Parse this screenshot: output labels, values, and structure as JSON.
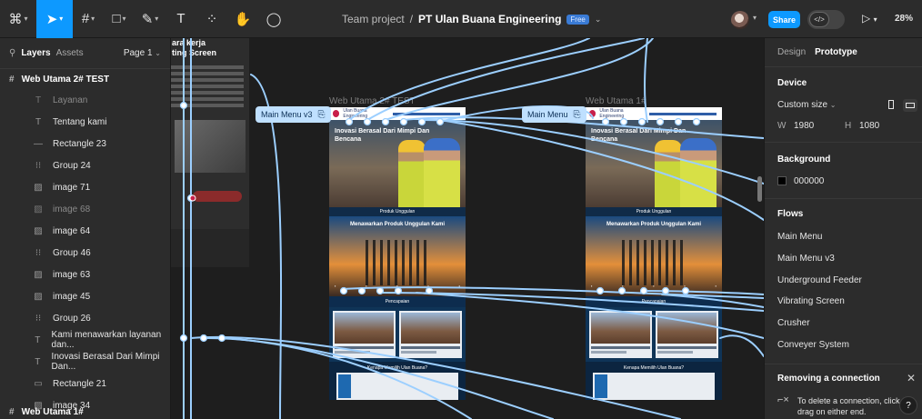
{
  "toolbar": {
    "main_menu_icon": "figma-logo-icon",
    "tools": [
      "move-tool-icon",
      "frame-tool-icon",
      "shape-tool-icon",
      "pen-tool-icon",
      "text-tool-icon",
      "resources-icon",
      "hand-tool-icon",
      "comment-icon"
    ],
    "text_tool_glyph": "T",
    "team": "Team project",
    "separator": "/",
    "file_name": "PT Ulan Buana Engineering",
    "plan_badge": "Free",
    "share_label": "Share",
    "zoom": "28%"
  },
  "left_panel": {
    "tab_layers": "Layers",
    "tab_assets": "Assets",
    "page": "Page 1",
    "top_frame": "Web Utama 2# TEST",
    "layers": [
      {
        "icon": "text-icon",
        "label": "Layanan",
        "dim": true
      },
      {
        "icon": "text-icon",
        "label": "Tentang kami",
        "dim": false
      },
      {
        "icon": "line-icon",
        "label": "Rectangle 23",
        "dim": false
      },
      {
        "icon": "group-icon",
        "label": "Group 24",
        "dim": false
      },
      {
        "icon": "image-icon",
        "label": "image 71",
        "dim": false
      },
      {
        "icon": "image-icon",
        "label": "image 68",
        "dim": true
      },
      {
        "icon": "image-icon",
        "label": "image 64",
        "dim": false
      },
      {
        "icon": "group-icon",
        "label": "Group 46",
        "dim": false
      },
      {
        "icon": "image-icon",
        "label": "image 63",
        "dim": false
      },
      {
        "icon": "image-icon",
        "label": "image 45",
        "dim": false
      },
      {
        "icon": "group-icon",
        "label": "Group 26",
        "dim": false
      },
      {
        "icon": "text-icon",
        "label": "Kami menawarkan layanan dan...",
        "dim": false
      },
      {
        "icon": "text-icon",
        "label": "Inovasi Berasal Dari Mimpi Dan...",
        "dim": false
      },
      {
        "icon": "rectangle-icon",
        "label": "Rectangle 21",
        "dim": false
      },
      {
        "icon": "image-icon",
        "label": "image 34",
        "dim": false
      }
    ],
    "bottom_frame": "Web Utama 1#"
  },
  "canvas": {
    "doc_heading_1": "ara kerja",
    "doc_heading_2": "ting Screen",
    "frame2_label": "Web Utama 2# TEST",
    "frame1_label": "Web Utama 1#",
    "flow_tag_v3": "Main Menu v3",
    "flow_tag_main": "Main Menu",
    "site": {
      "logo_text": "Ulan Buana Engineering",
      "hero_title": "Inovasi Berasal Dari Mimpi Dan Bencana",
      "section_products": "Produk Unggulan",
      "products_banner": "Menawarkan Produk Unggulan Kami",
      "section_projects": "Pencapaian",
      "why_title": "Kenapa Memilih Ulan Buana?"
    }
  },
  "right_panel": {
    "tab_design": "Design",
    "tab_prototype": "Prototype",
    "device_title": "Device",
    "device_value": "Custom size",
    "w_label": "W",
    "w_value": "1980",
    "h_label": "H",
    "h_value": "1080",
    "background_title": "Background",
    "background_value": "000000",
    "flows_title": "Flows",
    "flows": [
      "Main Menu",
      "Main Menu v3",
      "Underground Feeder",
      "Vibrating Screen",
      "Crusher",
      "Conveyer System"
    ],
    "toast_title": "Removing a connection",
    "toast_body": "To delete a connection, click drag on either end.",
    "help": "?"
  },
  "colors": {
    "accent": "#0d99ff",
    "connector": "#9ccfff",
    "panel": "#2c2c2c",
    "canvas": "#1e1e1e"
  }
}
